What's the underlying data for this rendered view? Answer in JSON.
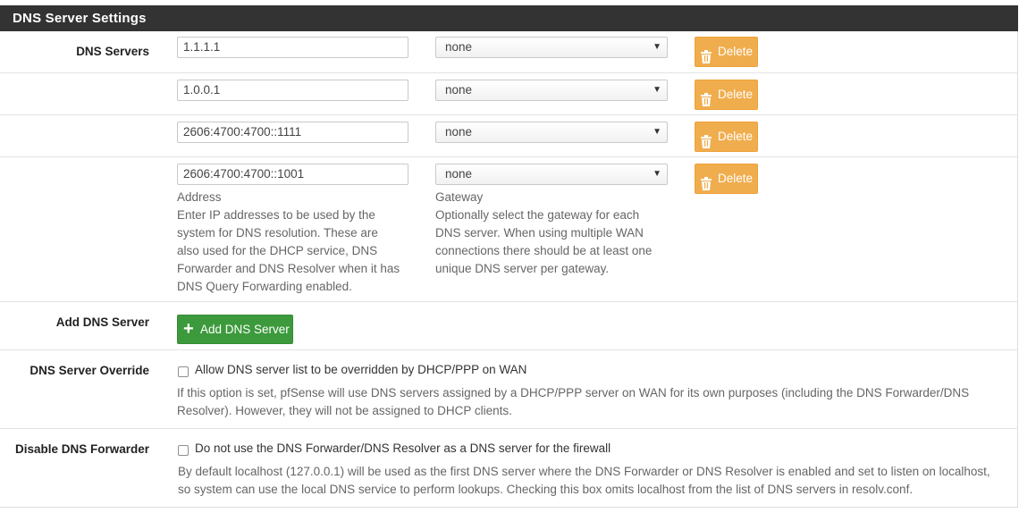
{
  "panel": {
    "title": "DNS Server Settings"
  },
  "dns_servers": {
    "label": "DNS Servers",
    "rows": [
      {
        "address": "1.1.1.1",
        "gateway": "none",
        "delete_label": "Delete"
      },
      {
        "address": "1.0.0.1",
        "gateway": "none",
        "delete_label": "Delete"
      },
      {
        "address": "2606:4700:4700::1111",
        "gateway": "none",
        "delete_label": "Delete"
      },
      {
        "address": "2606:4700:4700::1001",
        "gateway": "none",
        "delete_label": "Delete"
      }
    ],
    "address_help_title": "Address",
    "address_help_lines": [
      "Enter IP addresses to be used by the",
      "system for DNS resolution. These are",
      "also used for the DHCP service, DNS",
      "Forwarder and DNS Resolver when it has",
      "DNS Query Forwarding enabled."
    ],
    "gateway_help_title": "Gateway",
    "gateway_help_lines": [
      "Optionally select the gateway for each",
      "DNS server. When using multiple WAN",
      "connections there should be at least one",
      "unique DNS server per gateway."
    ]
  },
  "add_dns": {
    "label": "Add DNS Server",
    "button_label": "Add DNS Server"
  },
  "override": {
    "label": "DNS Server Override",
    "checkbox_label": "Allow DNS server list to be overridden by DHCP/PPP on WAN",
    "help_lines": [
      "If this option is set, pfSense will use DNS servers assigned by a DHCP/PPP server on WAN for its own purposes (including the DNS Forwarder/DNS",
      "Resolver). However, they will not be assigned to DHCP clients."
    ]
  },
  "disable_forwarder": {
    "label": "Disable DNS Forwarder",
    "checkbox_label": "Do not use the DNS Forwarder/DNS Resolver as a DNS server for the firewall",
    "help_lines": [
      "By default localhost (127.0.0.1) will be used as the first DNS server where the DNS Forwarder or DNS Resolver is enabled and set to listen on localhost,",
      "so system can use the local DNS service to perform lookups. Checking this box omits localhost from the list of DNS servers in resolv.conf."
    ]
  },
  "colors": {
    "header_bg": "#333333",
    "delete_btn": "#f0ad4e",
    "add_btn": "#3c9a3c"
  },
  "icons": {
    "delete": "trash-icon",
    "add": "plus-icon",
    "select": "caret-down-icon"
  }
}
